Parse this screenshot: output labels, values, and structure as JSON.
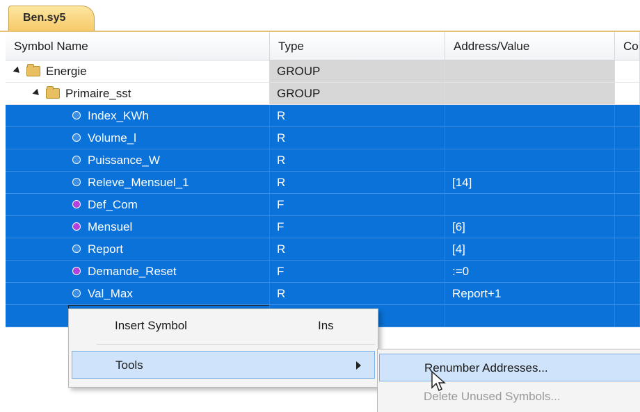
{
  "tab": {
    "label": "Ben.sy5"
  },
  "columns": [
    "Symbol Name",
    "Type",
    "Address/Value",
    "Con"
  ],
  "rows": [
    {
      "name": "Energie",
      "type": "GROUP",
      "address": "",
      "kind": "group",
      "level": 0
    },
    {
      "name": "Primaire_sst",
      "type": "GROUP",
      "address": "",
      "kind": "group",
      "level": 1
    },
    {
      "name": "Index_KWh",
      "type": "R",
      "address": "",
      "kind": "symbol",
      "color": "#3a8ee6"
    },
    {
      "name": "Volume_l",
      "type": "R",
      "address": "",
      "kind": "symbol",
      "color": "#3a8ee6"
    },
    {
      "name": "Puissance_W",
      "type": "R",
      "address": "",
      "kind": "symbol",
      "color": "#3a8ee6"
    },
    {
      "name": "Releve_Mensuel_1",
      "type": "R",
      "address": "[14]",
      "kind": "symbol",
      "color": "#3a8ee6"
    },
    {
      "name": "Def_Com",
      "type": "F",
      "address": "",
      "kind": "symbol",
      "color": "#b040e0"
    },
    {
      "name": "Mensuel",
      "type": "F",
      "address": "[6]",
      "kind": "symbol",
      "color": "#b040e0"
    },
    {
      "name": "Report",
      "type": "R",
      "address": "[4]",
      "kind": "symbol",
      "color": "#3a8ee6"
    },
    {
      "name": "Demande_Reset",
      "type": "F",
      "address": ":=0",
      "kind": "symbol",
      "color": "#b040e0"
    },
    {
      "name": "Val_Max",
      "type": "R",
      "address": "Report+1",
      "kind": "symbol",
      "color": "#3a8ee6"
    }
  ],
  "context_menu": {
    "insert_symbol": {
      "label": "Insert Symbol",
      "shortcut": "Ins"
    },
    "tools": {
      "label": "Tools"
    }
  },
  "submenu": {
    "renumber": {
      "label": "Renumber Addresses..."
    },
    "delete_unused": {
      "label": "Delete Unused Symbols..."
    }
  },
  "colors": {
    "selection": "#0a72d8",
    "menu_hover": "#cfe3fa",
    "tab": "#f7c96a"
  }
}
